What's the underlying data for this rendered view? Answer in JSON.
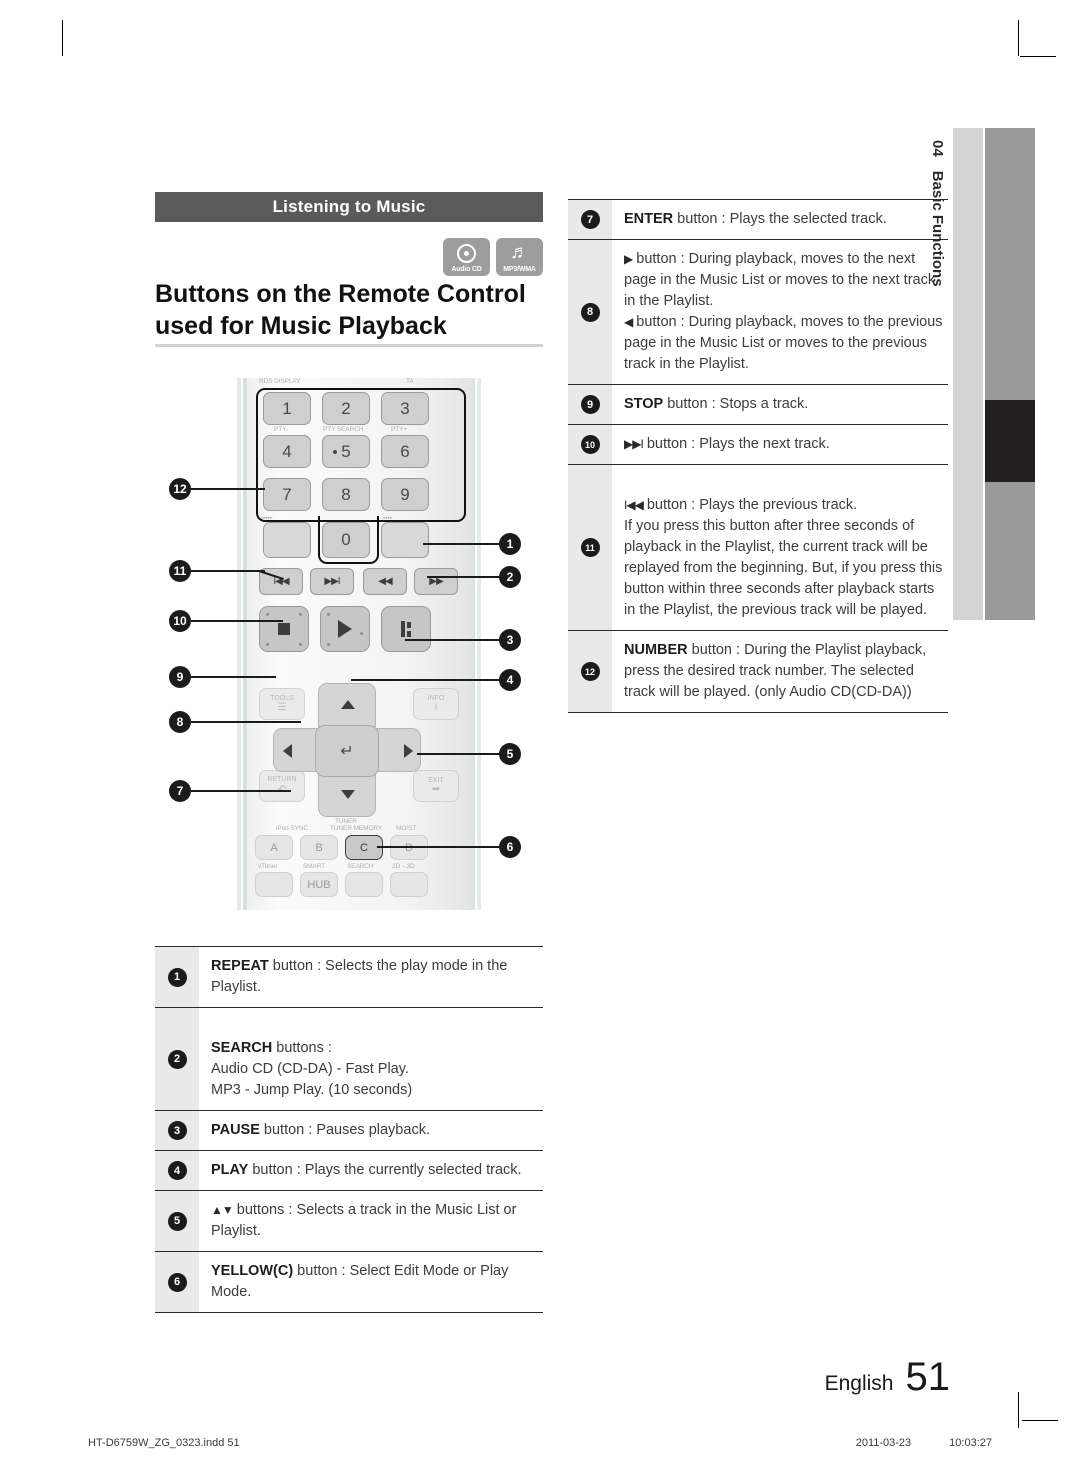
{
  "section_bar": {
    "label": "Listening to Music"
  },
  "media_badges": [
    {
      "icon": "audio-cd-icon",
      "caption": "Audio CD"
    },
    {
      "icon": "music-note-icon",
      "caption": "MP3/WMA"
    }
  ],
  "page_title": "Buttons on the Remote Control used for Music Playback",
  "remote": {
    "keypad": {
      "keys": [
        "1",
        "2",
        "3",
        "4",
        "5",
        "6",
        "7",
        "8",
        "9",
        "0"
      ],
      "micro_labels_top": [
        "RDS DISPLAY",
        "TA"
      ],
      "micro_labels_mid": [
        "PTY-",
        "PTY SEARCH",
        "PTY+"
      ]
    },
    "transport_top": [
      "prev-track-icon",
      "next-track-icon",
      "rewind-icon",
      "fast-forward-icon"
    ],
    "transport_main": [
      "stop-icon",
      "play-icon",
      "pause-icon"
    ],
    "nav_side_buttons": [
      "TOOLS",
      "INFO",
      "RETURN",
      "EXIT"
    ],
    "nav_micro_label": "TUNER",
    "color_buttons": [
      "A",
      "B",
      "C",
      "D"
    ],
    "color_micro_top": [
      "iPod SYNC",
      "TUNER MEMORY",
      "MO/ST"
    ],
    "color_micro_bottom": [
      "vTuner",
      "SMART",
      "SEARCH",
      "2D→3D"
    ],
    "hub_label": "HUB",
    "callouts_left": [
      "12",
      "11",
      "10",
      "9",
      "8",
      "7"
    ],
    "callouts_right": [
      "1",
      "2",
      "3",
      "4",
      "5",
      "6"
    ]
  },
  "table_left": {
    "rows": [
      {
        "num": "1",
        "bold": "REPEAT",
        "text": " button : Selects the play mode in the Playlist."
      },
      {
        "num": "2",
        "bold": "SEARCH",
        "text": " buttons :\nAudio CD (CD-DA) - Fast Play.\nMP3 - Jump Play. (10 seconds)"
      },
      {
        "num": "3",
        "bold": "PAUSE",
        "text": " button : Pauses playback."
      },
      {
        "num": "4",
        "bold": "PLAY",
        "text": " button : Plays the currently selected track."
      },
      {
        "num": "5",
        "bold": "",
        "sym": "▲▼",
        "text": " buttons : Selects a track in the Music List or Playlist."
      },
      {
        "num": "6",
        "bold": "YELLOW(C)",
        "text": " button : Select Edit Mode or Play Mode."
      }
    ]
  },
  "table_right": {
    "rows": [
      {
        "num": "7",
        "bold": "ENTER",
        "text": " button : Plays the selected track."
      },
      {
        "num": "8",
        "bold": "",
        "sym": "▶",
        "text": " button : During playback, moves to the next page in the Music List or moves to the next track in the Playlist.",
        "sym2": "◀",
        "text2": " button : During playback, moves to the previous page in the Music List or moves to the previous track in the Playlist."
      },
      {
        "num": "9",
        "bold": "STOP",
        "text": " button : Stops a track."
      },
      {
        "num": "10",
        "bold": "",
        "sym": "▶▶I",
        "text": " button : Plays the next track."
      },
      {
        "num": "11",
        "bold": "",
        "sym": "I◀◀",
        "text": " button : Plays the previous track.\nIf you press this button after three seconds of playback in the Playlist, the current track will be replayed from the beginning. But, if you press this button within three seconds after playback starts in the Playlist, the previous track will be played."
      },
      {
        "num": "12",
        "bold": "NUMBER",
        "text": " button : During the Playlist playback, press the desired track number. The selected track will be played. (only Audio CD(CD-DA))"
      }
    ]
  },
  "side_tab": {
    "chapter": "04",
    "label": "Basic Functions"
  },
  "footer": {
    "language": "English",
    "page_number": "51",
    "file_name": "HT-D6759W_ZG_0323.indd   51",
    "date": "2011-03-23",
    "time": "10:03:27"
  },
  "colors": {
    "bar": "#5a5a5a",
    "badge": "#9d9d9d",
    "numcell": "#e9e9e9",
    "tab": "#d4d4d4",
    "tab_gray": "#9a9a9a",
    "tab_black": "#231f20"
  }
}
